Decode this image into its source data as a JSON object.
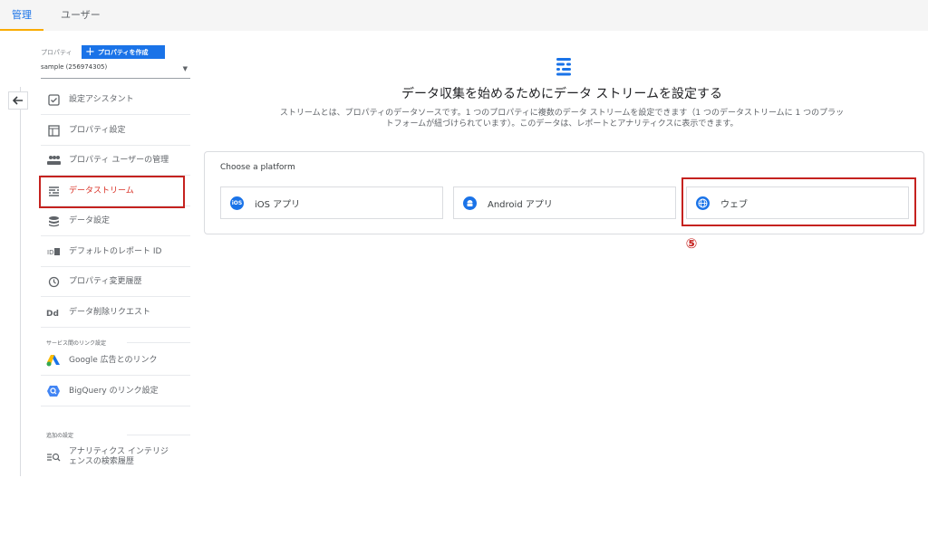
{
  "tabs": [
    {
      "label": "管理"
    },
    {
      "label": "ユーザー"
    }
  ],
  "sidebar": {
    "property_label": "プロパティ",
    "create_button": "プロパティを作成",
    "property_select": "sample (256974305)",
    "items": [
      {
        "label": "設定アシスタント",
        "icon": "checklist-icon"
      },
      {
        "label": "プロパティ設定",
        "icon": "window-icon"
      },
      {
        "label": "プロパティ ユーザーの管理",
        "icon": "people-icon"
      },
      {
        "label": "データストリーム",
        "icon": "streams-icon"
      },
      {
        "label": "データ設定",
        "icon": "database-icon"
      },
      {
        "label": "デフォルトのレポート ID",
        "icon": "id-icon"
      },
      {
        "label": "プロパティ変更履歴",
        "icon": "history-icon"
      },
      {
        "label": "データ削除リクエスト",
        "icon": "dd-icon"
      }
    ],
    "section_links": "サービス間のリンク設定",
    "links": [
      {
        "label": "Google 広告とのリンク",
        "icon": "google-ads-icon"
      },
      {
        "label": "BigQuery のリンク設定",
        "icon": "bigquery-icon"
      }
    ],
    "section_additional": "追加の設定",
    "additional": [
      {
        "label1": "アナリティクス インテリジ",
        "label2": "ェンスの検索履歴",
        "icon": "search-history-icon"
      }
    ]
  },
  "main": {
    "headline": "データ収集を始めるためにデータ ストリームを設定する",
    "desc_line1": "ストリームとは、プロパティのデータソースです。1 つのプロパティに複数のデータ ストリームを設定できます（1 つのデータストリームに 1 つのプラッ",
    "desc_line2": "トフォームが紐づけられています）。このデータは、レポートとアナリティクスに表示できます。",
    "card_title": "Choose a platform",
    "platforms": [
      {
        "label": "iOS アプリ",
        "icon": "ios-icon",
        "badge": "iOS"
      },
      {
        "label": "Android アプリ",
        "icon": "android-icon"
      },
      {
        "label": "ウェブ",
        "icon": "globe-icon"
      }
    ],
    "annotation": "⑤"
  },
  "colors": {
    "accent": "#1a73e8",
    "highlight": "#c5221f",
    "tab_underline": "#f9ab00"
  }
}
